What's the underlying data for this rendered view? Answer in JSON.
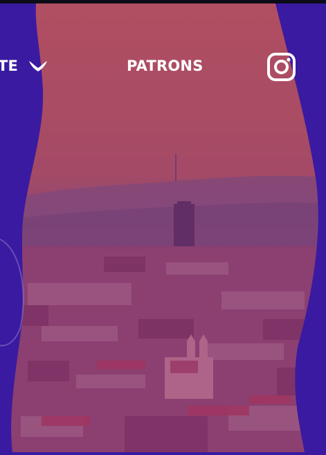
{
  "nav": {
    "partial_label": "TE",
    "patrons_label": "PATRONS"
  },
  "icons": {
    "dropdown": "chevron-down-icon",
    "social": "instagram-icon"
  },
  "colors": {
    "frame_purple": "#3a1aa0",
    "overlay_tint": "#8a3a78",
    "text": "#ffffff"
  }
}
